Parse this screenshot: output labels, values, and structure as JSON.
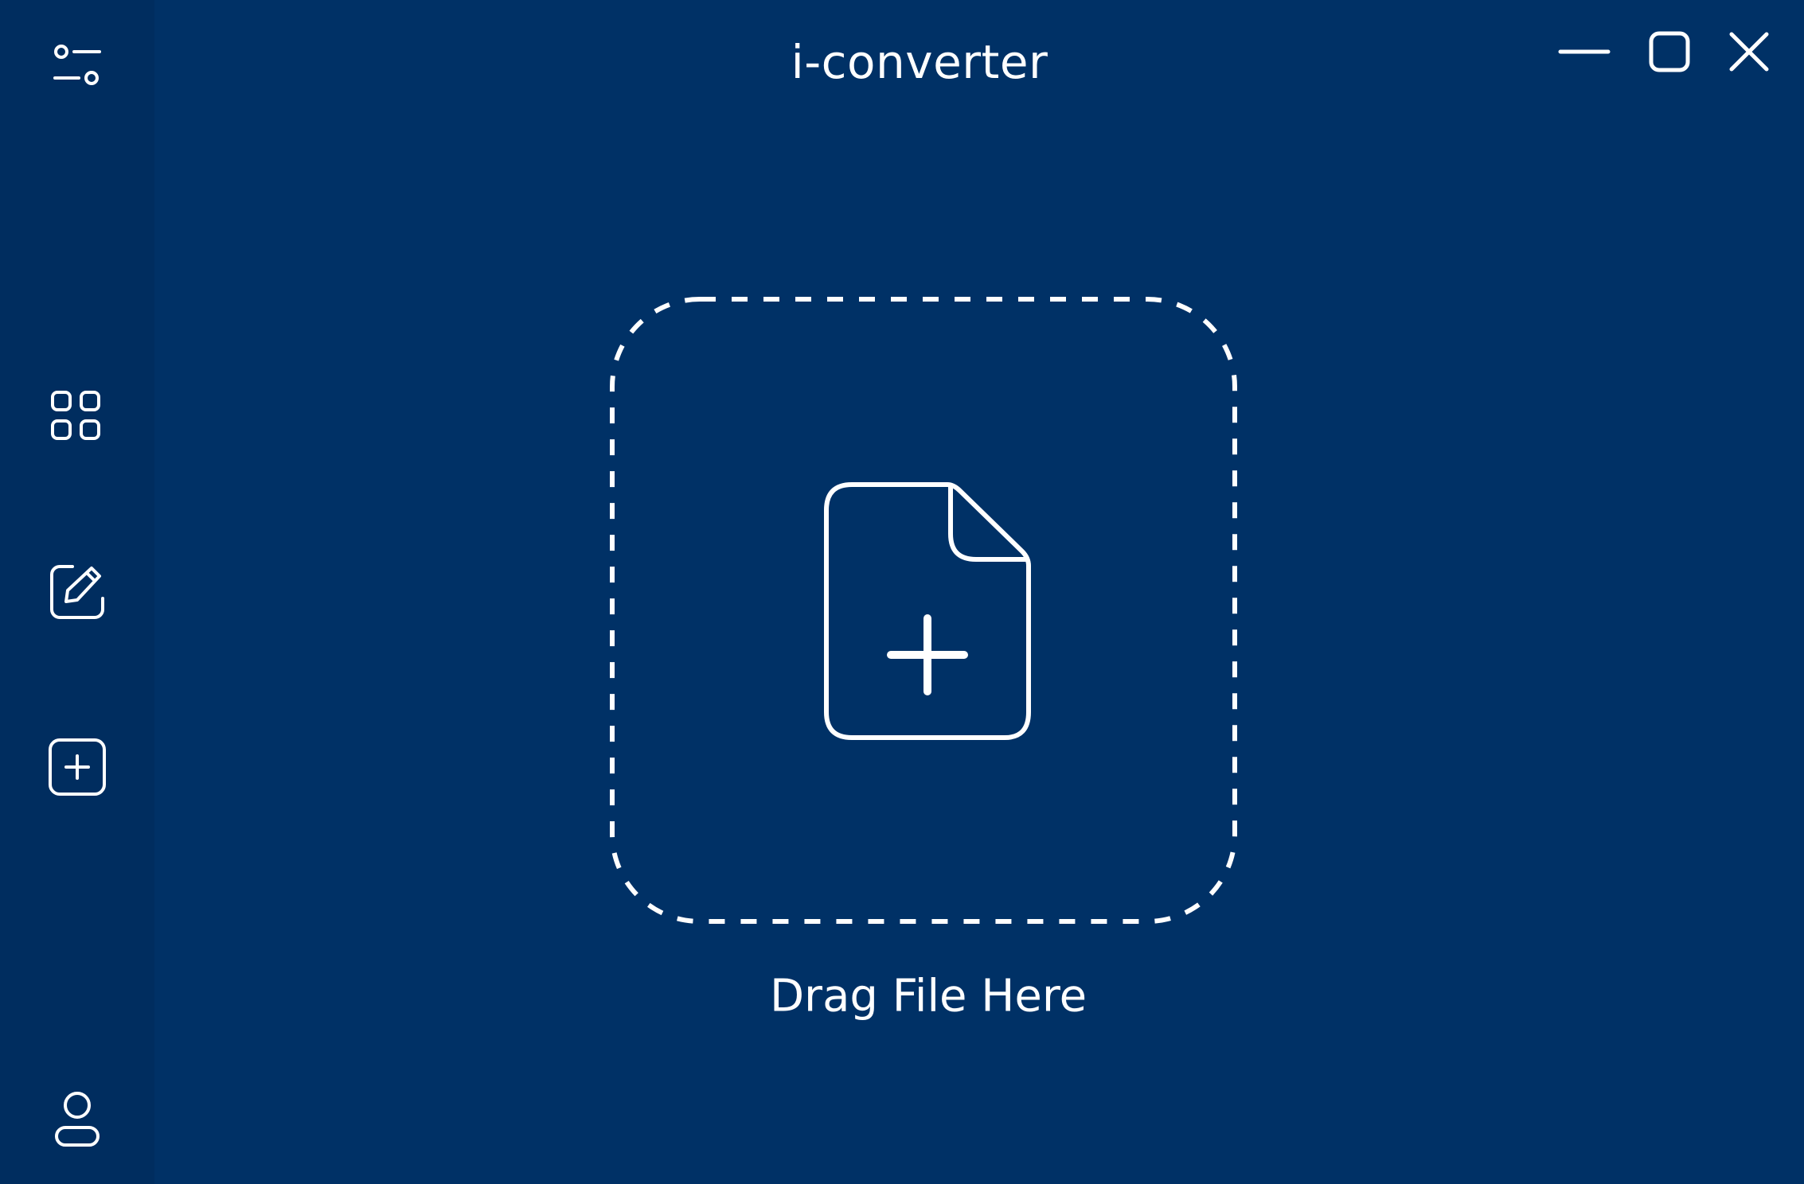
{
  "app": {
    "title": "i-converter",
    "background_color": "#003166",
    "sidebar_color": "#002d5f",
    "foreground_color": "#ffffff"
  },
  "window_controls": [
    {
      "name": "minimize",
      "icon": "minimize-icon"
    },
    {
      "name": "maximize",
      "icon": "maximize-icon"
    },
    {
      "name": "close",
      "icon": "close-icon"
    }
  ],
  "sidebar": {
    "items": [
      {
        "id": "settings",
        "icon": "sliders-icon"
      },
      {
        "id": "apps",
        "icon": "grid-icon"
      },
      {
        "id": "edit",
        "icon": "edit-icon"
      },
      {
        "id": "add",
        "icon": "plus-square-icon"
      },
      {
        "id": "account",
        "icon": "user-icon"
      }
    ]
  },
  "dropzone": {
    "icon": "file-add-icon",
    "label": "Drag File Here"
  }
}
